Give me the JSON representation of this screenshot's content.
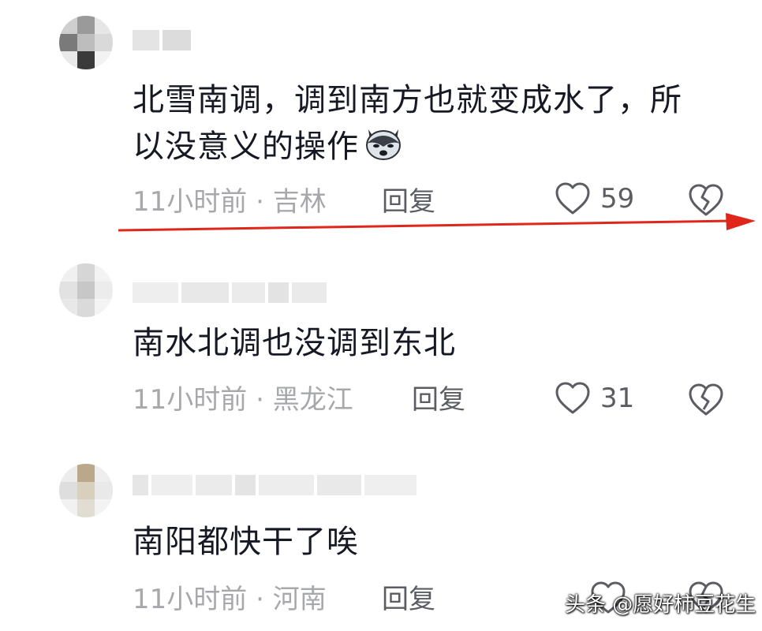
{
  "comments": [
    {
      "text_line1": "北雪南调，调到南方也就变成水了，所",
      "text_line2": "以没意义的操作",
      "emoji": "husky-emoji",
      "time": "11小时前",
      "location": "吉林",
      "reply_label": "回复",
      "likes": "59"
    },
    {
      "text_line1": "南水北调也没调到东北",
      "time": "11小时前",
      "location": "黑龙江",
      "reply_label": "回复",
      "likes": "31"
    },
    {
      "text_line1": "南阳都快干了唉",
      "time": "11小时前",
      "location": "河南",
      "reply_label": "回复"
    }
  ],
  "separator": " · ",
  "watermark": "头条 @愿好柿豆花生",
  "colors": {
    "text": "#161823",
    "meta": "#a7a8ac",
    "action": "#5b5d63",
    "arrow": "#e0261b"
  }
}
